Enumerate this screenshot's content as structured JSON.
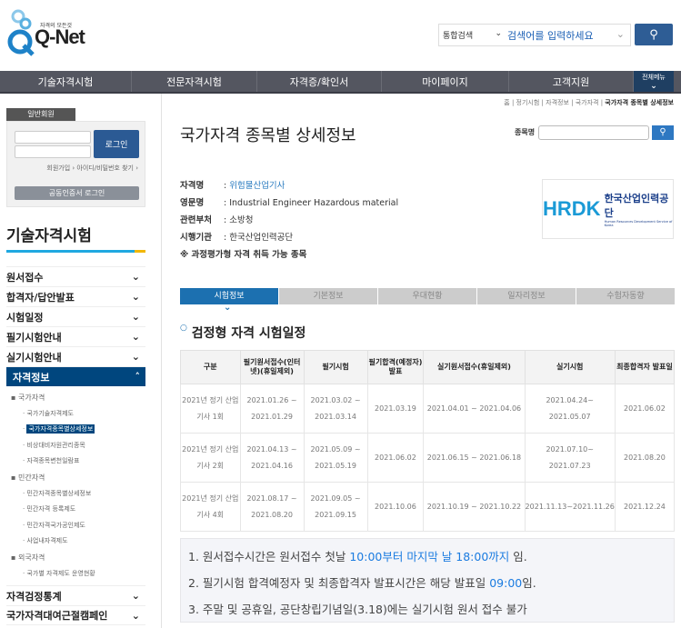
{
  "header": {
    "logo_text": "Q-Net",
    "logo_slogan": "자격의 모든것",
    "search_scope": "통합검색",
    "search_placeholder": "검색어를 입력하세요"
  },
  "nav": {
    "items": [
      "기술자격시험",
      "전문자격시험",
      "자격증/확인서",
      "마이페이지",
      "고객지원"
    ],
    "all_menu": "전체메뉴"
  },
  "login": {
    "tab": "일반회원",
    "button": "로그인",
    "join": "회원가입",
    "find": "아이디/비밀번호 찾기",
    "cert": "공동인증서 로그인"
  },
  "sidebar": {
    "title": "기술자격시험",
    "menu": [
      "원서접수",
      "합격자/답안발표",
      "시험일정",
      "필기시험안내",
      "실기시험안내"
    ],
    "active": "자격정보",
    "sub": [
      {
        "t": "국가자격",
        "l": 1
      },
      {
        "t": "국가기술자격제도",
        "l": 2
      },
      {
        "t": "국가자격종목별상세정보",
        "l": 2,
        "cur": true
      },
      {
        "t": "비상대비자원관리종목",
        "l": 2
      },
      {
        "t": "자격종목변천일람표",
        "l": 2
      },
      {
        "t": "민간자격",
        "l": 1
      },
      {
        "t": "민간자격종목별상세정보",
        "l": 2
      },
      {
        "t": "민간자격 등록제도",
        "l": 2
      },
      {
        "t": "민간자격국가공인제도",
        "l": 2
      },
      {
        "t": "사업내자격제도",
        "l": 2
      },
      {
        "t": "외국자격",
        "l": 1
      },
      {
        "t": "국가별 자격제도 운영현황",
        "l": 2
      }
    ],
    "bottom": [
      "자격검정통계",
      "국가자격대여근절캠페인"
    ]
  },
  "breadcrumb": [
    "홈",
    "정기시험",
    "자격정보",
    "국가자격",
    "국가자격 종목별 상세정보"
  ],
  "page": {
    "title": "국가자격 종목별 상세정보",
    "search_label": "종목명"
  },
  "info": {
    "rows": [
      {
        "k": "자격명",
        "v": "위험물산업기사"
      },
      {
        "k": "영문명",
        "v": "Industrial Engineer Hazardous material"
      },
      {
        "k": "관련부처",
        "v": "소방청"
      },
      {
        "k": "시행기관",
        "v": "한국산업인력공단"
      }
    ],
    "note": "※ 과정평가형 자격 취득 가능 종목",
    "org_logo": "HRDK",
    "org_name": "한국산업인력공단",
    "org_en": "Human Resources Development Service of Korea"
  },
  "tabs": [
    "시험정보",
    "기본정보",
    "우대현황",
    "일자리정보",
    "수험자동향"
  ],
  "section_title": "검정형 자격 시험일정",
  "table": {
    "headers": [
      "구분",
      "필기원서접수(인터넷)(휴일제외)",
      "필기시험",
      "필기합격(예정자)발표",
      "실기원서접수(휴일제외)",
      "실기시험",
      "최종합격자 발표일"
    ],
    "rows": [
      [
        "2021년 정기 산업기사 1회",
        "2021.01.26 ~ 2021.01.29",
        "2021.03.02 ~ 2021.03.14",
        "2021.03.19",
        "2021.04.01 ~ 2021.04.06",
        "2021.04.24~ 2021.05.07",
        "2021.06.02"
      ],
      [
        "2021년 정기 산업기사 2회",
        "2021.04.13 ~ 2021.04.16",
        "2021.05.09 ~ 2021.05.19",
        "2021.06.02",
        "2021.06.15 ~ 2021.06.18",
        "2021.07.10~ 2021.07.23",
        "2021.08.20"
      ],
      [
        "2021년 정기 산업기사 4회",
        "2021.08.17 ~ 2021.08.20",
        "2021.09.05 ~ 2021.09.15",
        "2021.10.06",
        "2021.10.19 ~ 2021.10.22",
        "2021.11.13~2021.11.26",
        "2021.12.24"
      ]
    ]
  },
  "notes": [
    {
      "a": "1. 원서접수시간은 원서접수 첫날 ",
      "h": "10:00부터 마지막 날 18:00까지",
      "b": " 임."
    },
    {
      "a": "2. 필기시험 합격예정자 및 최종합격자 발표시간은 해당 발표일 ",
      "h": "09:00",
      "b": "임."
    },
    {
      "a": "3. 주말 및 공휴일, 공단창립기념일(3.18)에는 실기시험 원서 접수 불가",
      "h": "",
      "b": ""
    }
  ],
  "colors": {
    "nav": "#545660",
    "active": "#00467e",
    "tab": "#1c70b0",
    "highlight": "#1a7be0"
  }
}
